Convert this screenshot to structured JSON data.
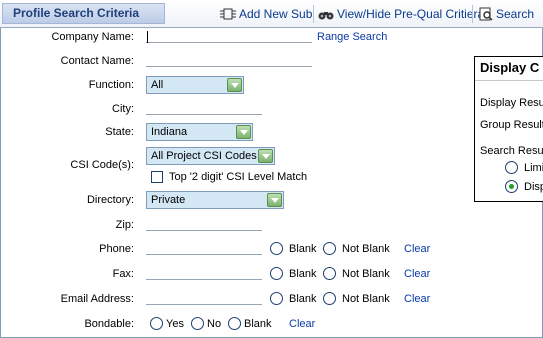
{
  "toolbar": {
    "title": "Profile Search Criteria",
    "add_new_sub": "Add New Sub",
    "view_hide": "View/Hide Pre-Qual Critiera",
    "search": "Search"
  },
  "form": {
    "company_name": {
      "label": "Company Name:",
      "value": "",
      "range_link": "Range Search"
    },
    "contact_name": {
      "label": "Contact Name:",
      "value": ""
    },
    "function": {
      "label": "Function:",
      "selected": "All"
    },
    "city": {
      "label": "City:",
      "value": ""
    },
    "state": {
      "label": "State:",
      "selected": "Indiana"
    },
    "csi_codes": {
      "label": "CSI Code(s):",
      "selected": "All Project CSI Codes",
      "checkbox_label": "Top '2 digit' CSI Level Match",
      "checkbox_checked": false
    },
    "directory": {
      "label": "Directory:",
      "selected": "Private"
    },
    "zip": {
      "label": "Zip:",
      "value": ""
    },
    "phone": {
      "label": "Phone:",
      "value": ""
    },
    "fax": {
      "label": "Fax:",
      "value": ""
    },
    "email": {
      "label": "Email Address:",
      "value": ""
    },
    "blank_label": "Blank",
    "not_blank_label": "Not Blank",
    "clear_label": "Clear",
    "bondable": {
      "label": "Bondable:",
      "yes": "Yes",
      "no": "No",
      "blank": "Blank"
    }
  },
  "display_panel": {
    "title": "Display C",
    "line1": "Display Resu",
    "line2": "Group Result",
    "line3": "Search Resu",
    "opt_limit": "Limi",
    "opt_disp": "Disp",
    "selected": "Disp"
  }
}
